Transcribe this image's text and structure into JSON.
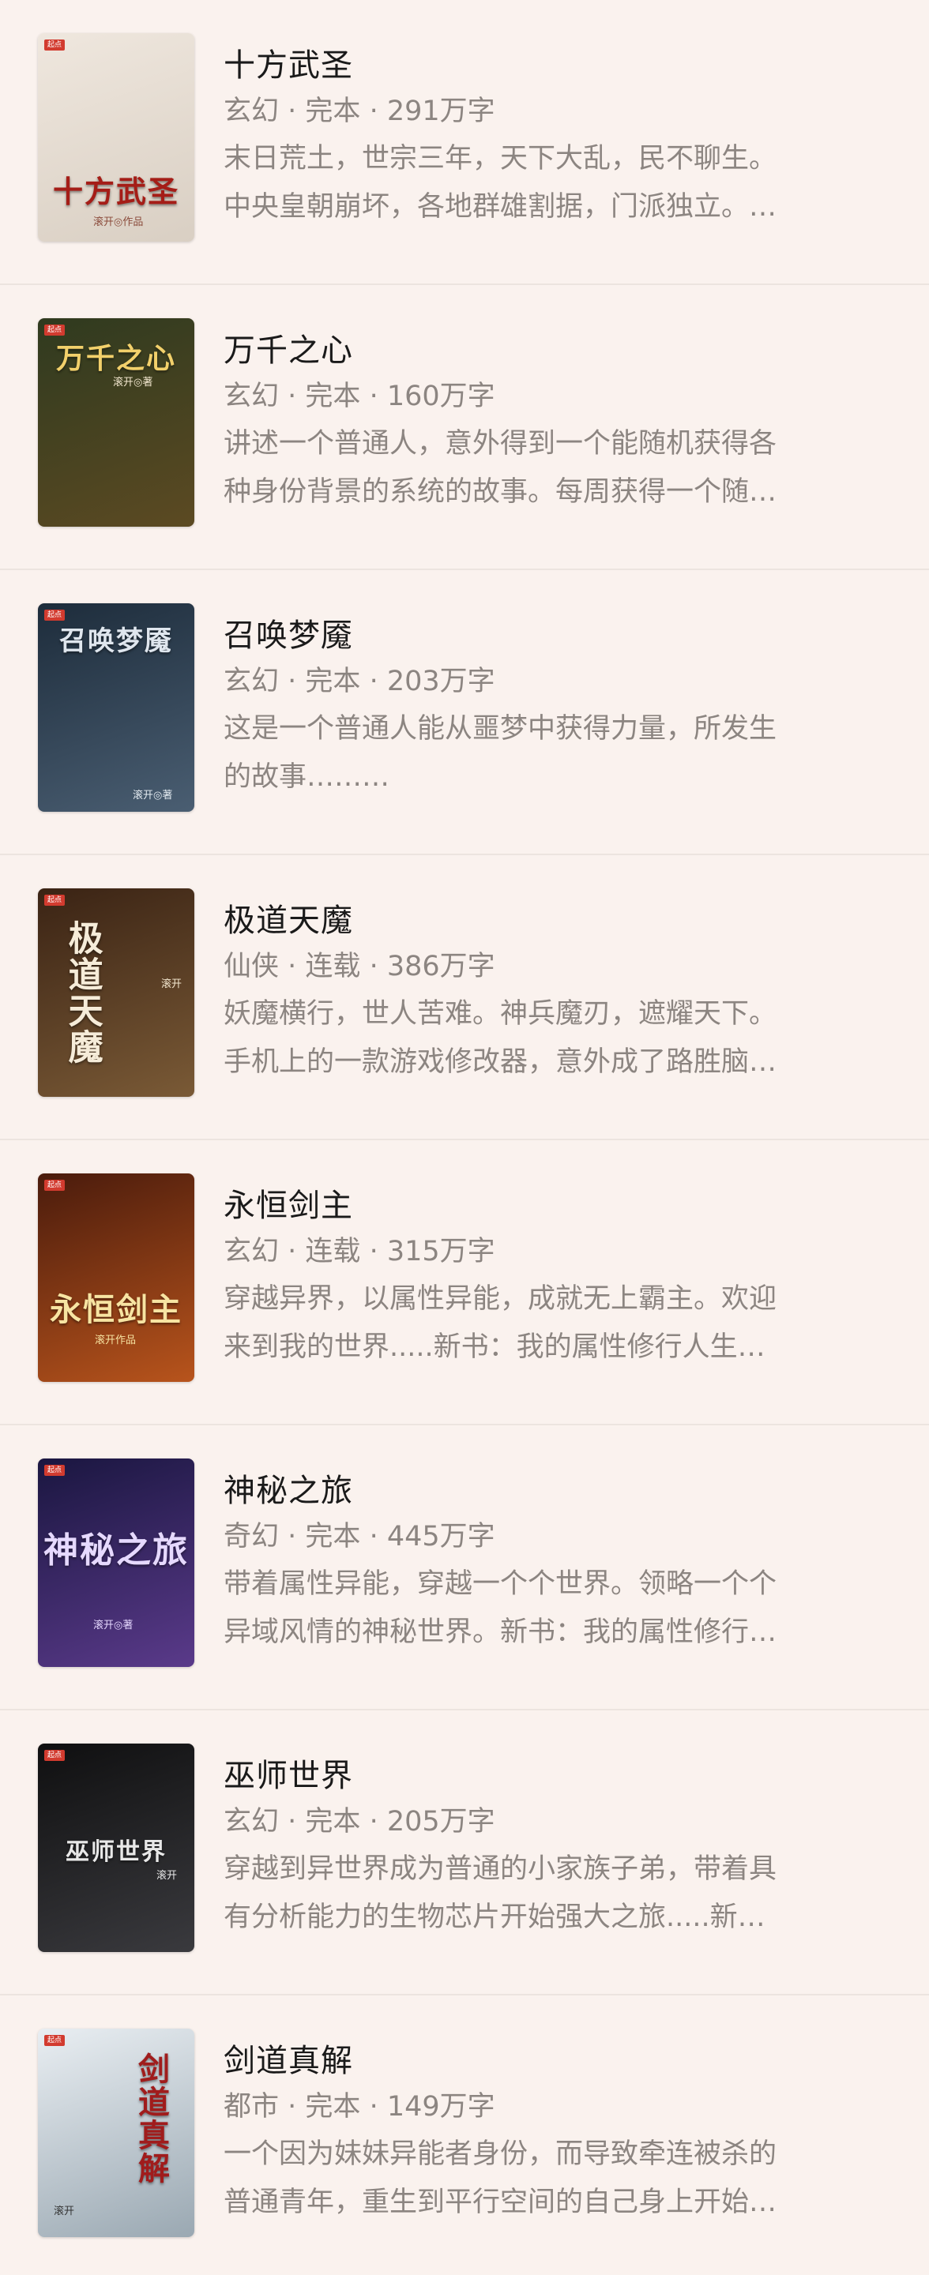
{
  "books": [
    {
      "title": "十方武圣",
      "genre": "玄幻",
      "status": "完本",
      "words": "291万字",
      "desc_line1": "末日荒土，世宗三年，天下大乱，民不聊生。",
      "desc_line2": "中央皇朝崩坏，各地群雄割据，门派独立。…",
      "cover_title": "十方武圣",
      "cover_author": "滚开◎作品",
      "cover_colors": [
        "#efe7de",
        "#d9cfc3"
      ],
      "cover_title_color": "#a51d17"
    },
    {
      "title": "万千之心",
      "genre": "玄幻",
      "status": "完本",
      "words": "160万字",
      "desc_line1": "讲述一个普通人，意外得到一个能随机获得各",
      "desc_line2": "种身份背景的系统的故事。每周获得一个随…",
      "cover_title": "万千之心",
      "cover_author": "滚开◎著",
      "cover_colors": [
        "#2f3a1f",
        "#5c4a22"
      ],
      "cover_title_color": "#f2d06b"
    },
    {
      "title": "召唤梦魇",
      "genre": "玄幻",
      "status": "完本",
      "words": "203万字",
      "desc_line1": "这是一个普通人能从噩梦中获得力量，所发生",
      "desc_line2": "的故事………",
      "cover_title": "召唤梦魇",
      "cover_author": "滚开◎著",
      "cover_colors": [
        "#1d2c3b",
        "#4a5e72"
      ],
      "cover_title_color": "#dfe6ee"
    },
    {
      "title": "极道天魔",
      "genre": "仙侠",
      "status": "连载",
      "words": "386万字",
      "desc_line1": "妖魔横行，世人苦难。神兵魔刃，遮耀天下。",
      "desc_line2": "手机上的一款游戏修改器，意外成了路胜脑…",
      "cover_title": "极道天魔",
      "cover_author": "滚开",
      "cover_colors": [
        "#3a2314",
        "#7a5a36"
      ],
      "cover_title_color": "#f6ecd9"
    },
    {
      "title": "永恒剑主",
      "genre": "玄幻",
      "status": "连载",
      "words": "315万字",
      "desc_line1": "穿越异界，以属性异能，成就无上霸主。欢迎",
      "desc_line2": "来到我的世界.....新书：我的属性修行人生…",
      "cover_title": "永恒剑主",
      "cover_author": "滚开作品",
      "cover_colors": [
        "#4a1b0c",
        "#b8541c"
      ],
      "cover_title_color": "#f7e4a2"
    },
    {
      "title": "神秘之旅",
      "genre": "奇幻",
      "status": "完本",
      "words": "445万字",
      "desc_line1": "带着属性异能，穿越一个个世界。领略一个个",
      "desc_line2": "异域风情的神秘世界。新书：我的属性修行…",
      "cover_title": "神秘之旅",
      "cover_author": "滚开◎著",
      "cover_colors": [
        "#1a1640",
        "#5a3a8a"
      ],
      "cover_title_color": "#e6d9ff"
    },
    {
      "title": "巫师世界",
      "genre": "玄幻",
      "status": "完本",
      "words": "205万字",
      "desc_line1": "穿越到异世界成为普通的小家族子弟，带着具",
      "desc_line2": "有分析能力的生物芯片开始强大之旅.....新…",
      "cover_title": "巫师世界",
      "cover_author": "滚开",
      "cover_colors": [
        "#0f0f10",
        "#3a3a3e"
      ],
      "cover_title_color": "#e8e8e8"
    },
    {
      "title": "剑道真解",
      "genre": "都市",
      "status": "完本",
      "words": "149万字",
      "desc_line1": "一个因为妹妹异能者身份，而导致牵连被杀的",
      "desc_line2": "普通青年，重生到平行空间的自己身上开始…",
      "cover_title": "剑道真解",
      "cover_author": "滚开",
      "cover_colors": [
        "#e9eef2",
        "#9aa8b2"
      ],
      "cover_title_color": "#a01c1c"
    }
  ]
}
